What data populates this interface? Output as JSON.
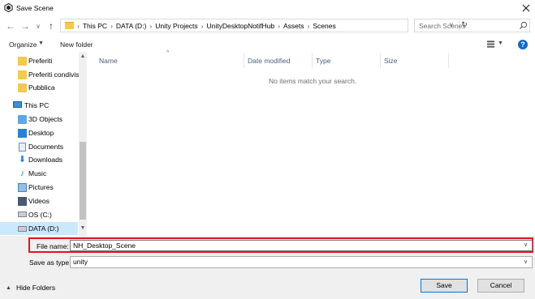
{
  "window": {
    "title": "Save Scene"
  },
  "nav": {
    "back": "←",
    "forward": "→",
    "recent": "∨",
    "up": "↑",
    "breadcrumbs": [
      "This PC",
      "DATA (D:)",
      "Unity Projects",
      "UnityDesktopNotifHub",
      "Assets",
      "Scenes"
    ],
    "separator": "›",
    "search_placeholder": "Search Scenes"
  },
  "toolbar": {
    "organize": "Organize",
    "new_folder": "New folder",
    "help": "?"
  },
  "sidebar": {
    "items": [
      {
        "label": "Preferiti",
        "icon": "folder-icon"
      },
      {
        "label": "Preferiti condivisi",
        "icon": "folder-icon"
      },
      {
        "label": "Pubblica",
        "icon": "folder-icon"
      },
      {
        "label": "This PC",
        "icon": "computer-icon"
      },
      {
        "label": "3D Objects",
        "icon": "cube-icon"
      },
      {
        "label": "Desktop",
        "icon": "desktop-icon"
      },
      {
        "label": "Documents",
        "icon": "documents-icon"
      },
      {
        "label": "Downloads",
        "icon": "download-icon"
      },
      {
        "label": "Music",
        "icon": "music-icon"
      },
      {
        "label": "Pictures",
        "icon": "pictures-icon"
      },
      {
        "label": "Videos",
        "icon": "videos-icon"
      },
      {
        "label": "OS (C:)",
        "icon": "drive-icon"
      },
      {
        "label": "DATA (D:)",
        "icon": "drive-icon",
        "selected": true
      }
    ]
  },
  "file_list": {
    "columns": [
      "Name",
      "Date modified",
      "Type",
      "Size"
    ],
    "empty_message": "No items match your search."
  },
  "form": {
    "file_name_label": "File name:",
    "file_name_value": "NH_Desktop_Scene",
    "save_as_type_label": "Save as type:",
    "save_as_type_value": "unity"
  },
  "footer": {
    "hide_folders": "Hide Folders",
    "save": "Save",
    "cancel": "Cancel"
  },
  "colors": {
    "highlight": "#e3141f",
    "selection": "#cce8ff",
    "accent": "#0078d7"
  }
}
